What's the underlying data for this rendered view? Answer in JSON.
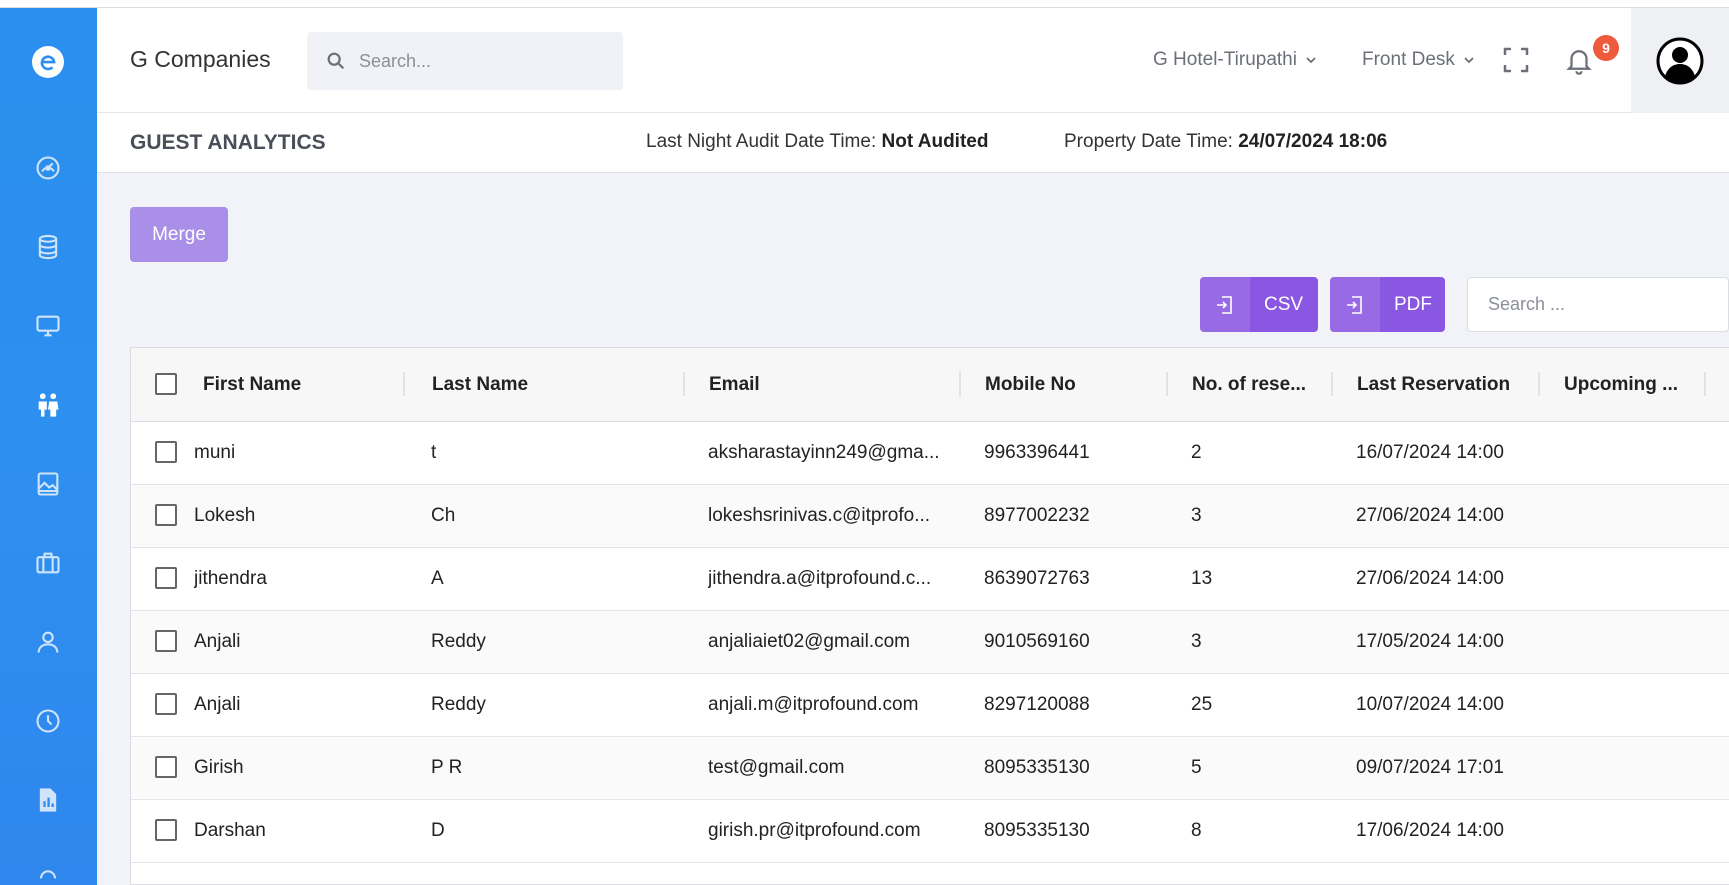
{
  "header": {
    "brand": "G Companies",
    "search_placeholder": "Search...",
    "property_selector": "G Hotel-Tirupathi",
    "role_selector": "Front Desk",
    "notification_count": "9"
  },
  "subheader": {
    "page_title": "GUEST ANALYTICS",
    "audit_label": "Last Night Audit Date Time:",
    "audit_value": "Not Audited",
    "property_dt_label": "Property Date Time:",
    "property_dt_value": "24/07/2024 18:06"
  },
  "toolbar": {
    "merge_label": "Merge",
    "csv_label": "CSV",
    "pdf_label": "PDF",
    "table_search_placeholder": "Search ..."
  },
  "sidebar": {
    "items": [
      "dashboard-icon",
      "database-icon",
      "monitor-icon",
      "guests-icon",
      "gallery-icon",
      "briefcase-icon",
      "user-icon",
      "clock-icon",
      "report-icon"
    ],
    "active": "guests-icon"
  },
  "table": {
    "columns": [
      "First Name",
      "Last Name",
      "Email",
      "Mobile No",
      "No. of rese...",
      "Last Reservation",
      "Upcoming ..."
    ],
    "rows": [
      {
        "first": "muni",
        "last": "t",
        "email": "aksharastayinn249@gma...",
        "mobile": "9963396441",
        "count": "2",
        "last_res": "16/07/2024 14:00",
        "upcoming": ""
      },
      {
        "first": "Lokesh",
        "last": "Ch",
        "email": "lokeshsrinivas.c@itprofo...",
        "mobile": "8977002232",
        "count": "3",
        "last_res": "27/06/2024 14:00",
        "upcoming": ""
      },
      {
        "first": "jithendra",
        "last": "A",
        "email": "jithendra.a@itprofound.c...",
        "mobile": "8639072763",
        "count": "13",
        "last_res": "27/06/2024 14:00",
        "upcoming": ""
      },
      {
        "first": "Anjali",
        "last": "Reddy",
        "email": "anjaliaiet02@gmail.com",
        "mobile": "9010569160",
        "count": "3",
        "last_res": "17/05/2024 14:00",
        "upcoming": ""
      },
      {
        "first": "Anjali",
        "last": "Reddy",
        "email": "anjali.m@itprofound.com",
        "mobile": "8297120088",
        "count": "25",
        "last_res": "10/07/2024 14:00",
        "upcoming": ""
      },
      {
        "first": "Girish",
        "last": "P R",
        "email": "test@gmail.com",
        "mobile": "8095335130",
        "count": "5",
        "last_res": "09/07/2024 17:01",
        "upcoming": ""
      },
      {
        "first": "Darshan",
        "last": "D",
        "email": "girish.pr@itprofound.com",
        "mobile": "8095335130",
        "count": "8",
        "last_res": "17/06/2024 14:00",
        "upcoming": ""
      }
    ]
  },
  "colors": {
    "sidebar": "#2e8ff0",
    "accent": "#8a57e2",
    "merge": "#a98fe8",
    "badge": "#f05a3c"
  }
}
